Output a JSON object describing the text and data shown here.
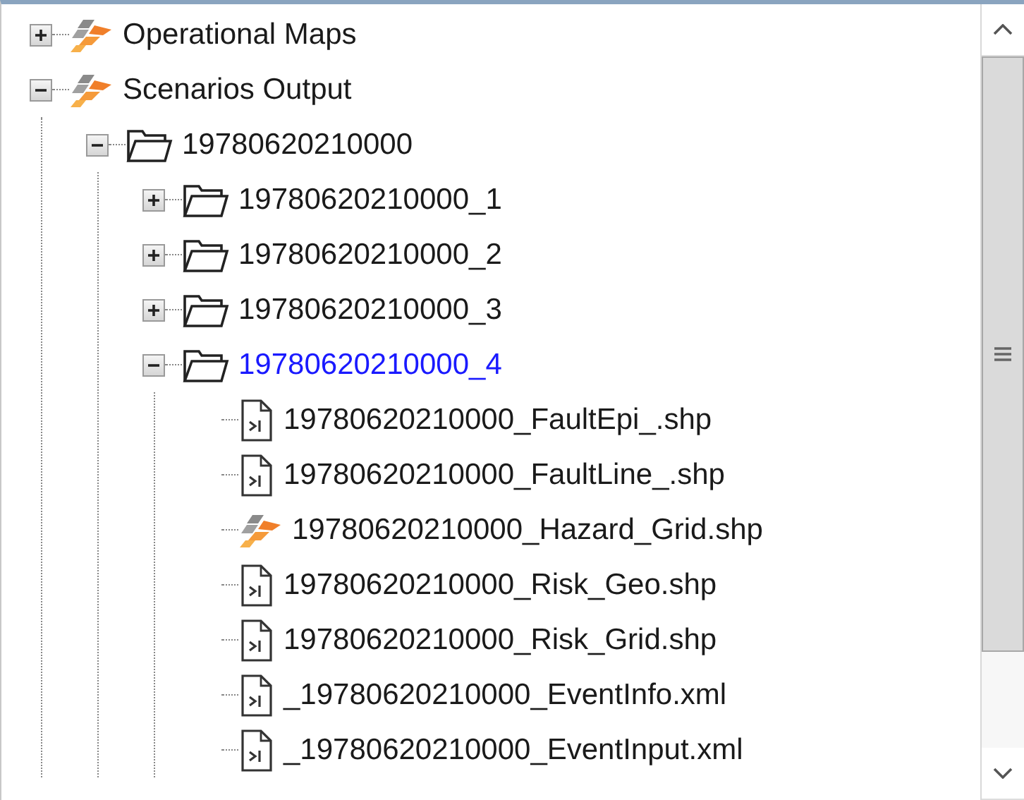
{
  "tree": [
    {
      "label": "Operational Maps",
      "kind": "layers",
      "expanded": false,
      "selected": false
    },
    {
      "label": "Scenarios Output",
      "kind": "layers",
      "expanded": true,
      "selected": false,
      "children": [
        {
          "label": "19780620210000",
          "kind": "folder",
          "expanded": true,
          "selected": false,
          "children": [
            {
              "label": "19780620210000_1",
              "kind": "folder",
              "expanded": false,
              "selected": false
            },
            {
              "label": "19780620210000_2",
              "kind": "folder",
              "expanded": false,
              "selected": false
            },
            {
              "label": "19780620210000_3",
              "kind": "folder",
              "expanded": false,
              "selected": false
            },
            {
              "label": "19780620210000_4",
              "kind": "folder",
              "expanded": true,
              "selected": true,
              "children": [
                {
                  "label": "19780620210000_FaultEpi_.shp",
                  "kind": "file",
                  "selected": false
                },
                {
                  "label": "19780620210000_FaultLine_.shp",
                  "kind": "file",
                  "selected": false
                },
                {
                  "label": "19780620210000_Hazard_Grid.shp",
                  "kind": "layers",
                  "selected": false
                },
                {
                  "label": "19780620210000_Risk_Geo.shp",
                  "kind": "file",
                  "selected": false
                },
                {
                  "label": "19780620210000_Risk_Grid.shp",
                  "kind": "file",
                  "selected": false
                },
                {
                  "label": "_19780620210000_EventInfo.xml",
                  "kind": "file",
                  "selected": false
                },
                {
                  "label": "_19780620210000_EventInput.xml",
                  "kind": "file",
                  "selected": false
                }
              ]
            }
          ]
        }
      ]
    }
  ]
}
